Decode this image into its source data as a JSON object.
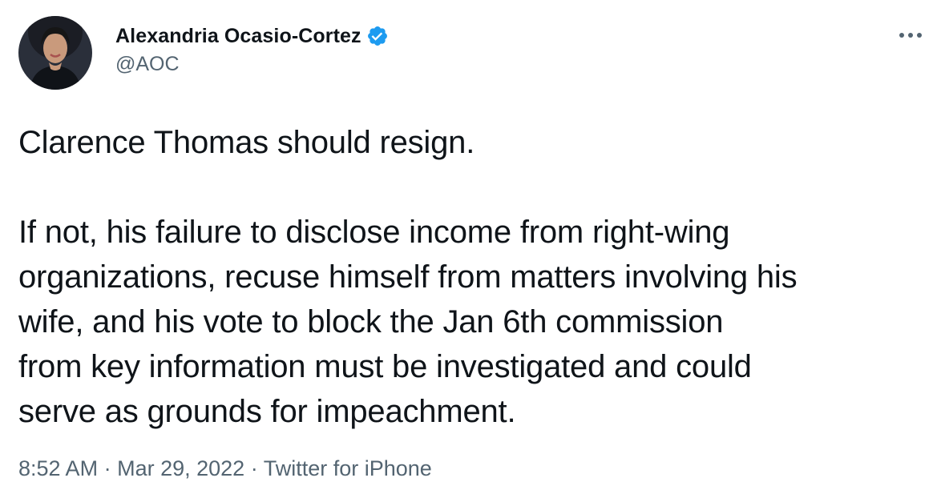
{
  "author": {
    "display_name": "Alexandria Ocasio-Cortez",
    "handle": "@AOC",
    "verified": true
  },
  "icons": {
    "avatar": "avatar",
    "verified": "verified-badge-icon",
    "more": "more-options-icon"
  },
  "colors": {
    "text": "#0f1419",
    "secondary": "#536471",
    "verified_blue": "#1d9bf0"
  },
  "tweet": {
    "paragraph1": "Clarence Thomas should resign.",
    "paragraph2": "If not, his failure to disclose income from right-wing\norganizations, recuse himself from matters involving his\nwife, and his vote to block the Jan 6th commission\nfrom key information must be investigated and could\nserve as grounds for impeachment."
  },
  "meta": {
    "time": "8:52 AM",
    "separator": "·",
    "date": "Mar 29, 2022",
    "source": "Twitter for iPhone"
  }
}
